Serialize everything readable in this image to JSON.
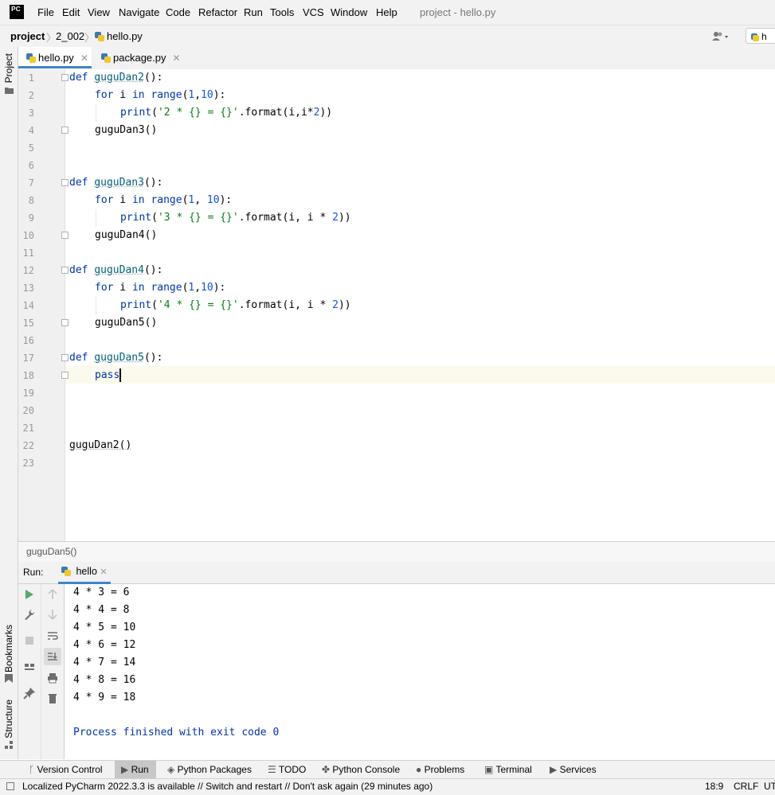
{
  "menubar": {
    "logo": "PC",
    "items": [
      "File",
      "Edit",
      "View",
      "Navigate",
      "Code",
      "Refactor",
      "Run",
      "Tools",
      "VCS",
      "Window",
      "Help"
    ],
    "window_title": "project - hello.py"
  },
  "navbar": {
    "crumbs": [
      "project",
      "2_002",
      "hello.py"
    ],
    "right_tab_partial": "h"
  },
  "left_strip": {
    "top": "Project",
    "mid": "Bookmarks",
    "bottom": "Structure"
  },
  "tabs": [
    {
      "label": "hello.py",
      "active": true
    },
    {
      "label": "package.py",
      "active": false
    }
  ],
  "code_breadcrumb": "guguDan5()",
  "run_panel": {
    "label": "Run:",
    "tab": "hello"
  },
  "console": {
    "lines": [
      "4 * 3 = 6",
      "4 * 4 = 8",
      "4 * 5 = 10",
      "4 * 6 = 12",
      "4 * 7 = 14",
      "4 * 8 = 16",
      "4 * 9 = 18"
    ],
    "finish": "Process finished with exit code 0"
  },
  "bottom_tabs": [
    "Version Control",
    "Run",
    "Python Packages",
    "TODO",
    "Python Console",
    "Problems",
    "Terminal",
    "Services"
  ],
  "status": {
    "message": "Localized PyCharm 2022.3.3 is available // Switch and restart // Don't ask again (29 minutes ago)",
    "position": "18:9",
    "line_sep": "CRLF",
    "encoding": "UT"
  },
  "code": {
    "numbers": [
      "1",
      "2",
      "3",
      "4",
      "5",
      "6",
      "7",
      "8",
      "9",
      "10",
      "11",
      "12",
      "13",
      "14",
      "15",
      "16",
      "17",
      "18",
      "19",
      "20",
      "21",
      "22",
      "23"
    ],
    "l1": {
      "kw": "def",
      "fn": "guguDan2",
      "rest": "():"
    },
    "l2": {
      "kw1": "for",
      "v": " i ",
      "kw2": "in",
      "fn": "range",
      "p1": "(",
      "n1": "1",
      "c": ",",
      "n2": "10",
      "p2": "):"
    },
    "l3": {
      "fn": "print",
      "p1": "(",
      "s": "'2 * {} = {}'",
      "m": ".format(i,i*",
      "n": "2",
      "p2": "))"
    },
    "l4": "guguDan3()",
    "l7": {
      "kw": "def",
      "fn": "guguDan3",
      "rest": "():"
    },
    "l8": {
      "kw1": "for",
      "v": " i ",
      "kw2": "in",
      "fn": "range",
      "p1": "(",
      "n1": "1",
      "c": ", ",
      "n2": "10",
      "p2": "):"
    },
    "l9": {
      "fn": "print",
      "p1": "(",
      "s": "'3 * {} = {}'",
      "m": ".format(i, i * ",
      "n": "2",
      "p2": "))"
    },
    "l10": "guguDan4()",
    "l12": {
      "kw": "def",
      "fn": "guguDan4",
      "rest": "():"
    },
    "l13": {
      "kw1": "for",
      "v": " i ",
      "kw2": "in",
      "fn": "range",
      "p1": "(",
      "n1": "1",
      "c": ",",
      "n2": "10",
      "p2": "):"
    },
    "l14": {
      "fn": "print",
      "p1": "(",
      "s": "'4 * {} = {}'",
      "m": ".format(i, i * ",
      "n": "2",
      "p2": "))"
    },
    "l15": "guguDan5()",
    "l17": {
      "kw": "def",
      "fn": "guguDan5",
      "rest": "():"
    },
    "l18": "pass",
    "l22": "guguDan2()"
  }
}
